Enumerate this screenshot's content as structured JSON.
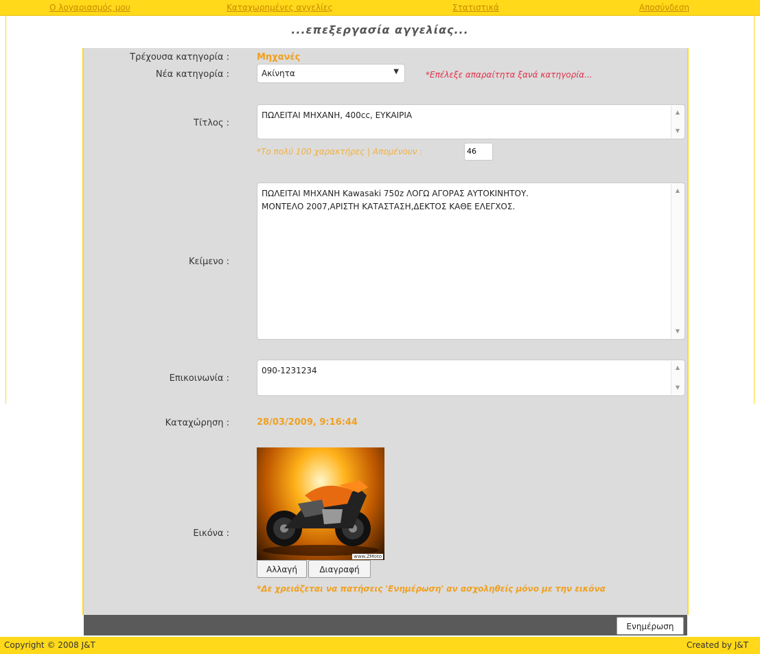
{
  "nav": {
    "account": "Ο λογαριασμός μου",
    "listings": "Καταχωρημένες αγγελίες",
    "stats": "Στατιστικά",
    "logout": "Αποσύνδεση"
  },
  "page_title": "...επεξεργασία αγγελίας...",
  "form": {
    "current_category_label": "Τρέχουσα κατηγορία :",
    "current_category_value": "Μηχανές",
    "new_category_label": "Νέα κατηγορία :",
    "new_category_value": "Ακίνητα",
    "new_category_hint": "*Επέλεξε απαραίτητα ξανά κατηγορία...",
    "title_label": "Τίτλος :",
    "title_value": "ΠΩΛΕΙΤΑΙ ΜΗΧΑΝΗ, 400cc, ΕΥΚΑΙΡΙΑ",
    "title_hint": "*Το πολύ 100 χαρακτήρες | Απομένουν :",
    "title_remaining": "46",
    "text_label": "Κείμενο :",
    "text_value": "ΠΩΛΕΙΤΑΙ ΜΗΧΑΝΗ Kawasaki 750z ΛΟΓΩ ΑΓΟΡΑΣ ΑΥΤΟΚΙΝΗΤΟΥ.\nΜΟΝΤΕΛΟ 2007,ΑΡΙΣΤΗ ΚΑΤΑΣΤΑΣΗ,ΔΕΚΤΟΣ ΚΑΘΕ ΕΛΕΓΧΟΣ.",
    "contact_label": "Επικοινωνία :",
    "contact_value": "090-1231234",
    "date_label": "Καταχώρηση :",
    "date_value": "28/03/2009, 9:16:44",
    "image_label": "Εικόνα :",
    "image_watermark": "www.ZMoto",
    "change_button": "Αλλαγή",
    "delete_button": "Διαγραφή",
    "image_hint": "*Δε χρειάζεται να πατήσεις 'Ενημέρωση' αν ασχοληθείς μόνο με την εικόνα",
    "update_button": "Ενημέρωση"
  },
  "footer": {
    "copyright": "Copyright © 2008 J&T",
    "created": "Created by J&T"
  },
  "colors": {
    "nav_bar": "#ffd91a",
    "panel": "#dcdcdc",
    "accent_orange": "#f0a020",
    "hint_red": "#e0304a",
    "bottom_bar": "#5a5a5a"
  }
}
